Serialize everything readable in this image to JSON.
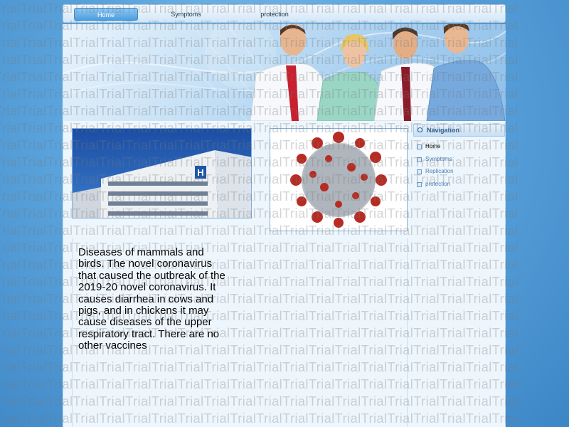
{
  "nav": {
    "tabs": [
      {
        "label": "Home",
        "active": true
      },
      {
        "label": "Symptoms",
        "active": false
      },
      {
        "label": "protection",
        "active": false
      }
    ]
  },
  "main": {
    "paragraph": "Diseases of mammals and birds. The novel coronavirus that caused the outbreak of the 2019-20 novel coronavirus. It causes diarrhea in cows and pigs, and in chickens it may cause diseases of the upper respiratory tract. There are no other vaccines",
    "hospital_sign": "H"
  },
  "sidebar": {
    "title": "Navigation",
    "items": [
      {
        "label": "Home",
        "current": true
      },
      {
        "label": "Symptoms",
        "current": false
      },
      {
        "label": "Replication",
        "current": false
      },
      {
        "label": "protection",
        "current": false
      }
    ]
  },
  "watermark": {
    "word": "Trial"
  },
  "colors": {
    "accent": "#4b9ee0",
    "link": "#4a7fb5",
    "background": "#5aa3dc"
  }
}
